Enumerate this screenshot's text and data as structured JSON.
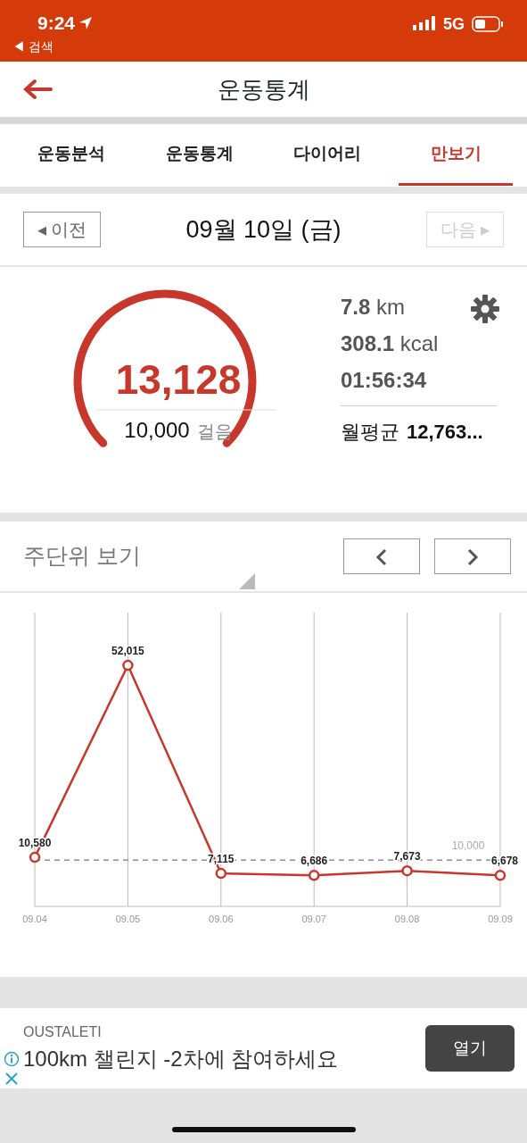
{
  "status_bar": {
    "time": "9:24",
    "back_label": "◀ 검색",
    "network": "5G"
  },
  "header": {
    "title": "운동통계"
  },
  "tabs": [
    {
      "label": "운동분석",
      "selected": false
    },
    {
      "label": "운동통계",
      "selected": false
    },
    {
      "label": "다이어리",
      "selected": false
    },
    {
      "label": "만보기",
      "selected": true
    }
  ],
  "date_nav": {
    "prev": "◂ 이전",
    "date": "09월 10일 (금)",
    "next": "다음 ▸",
    "next_disabled": true
  },
  "steps": {
    "count": "13,128",
    "goal": "10,000",
    "goal_unit": "걸음"
  },
  "stats": [
    {
      "value": "7.8",
      "unit": "km"
    },
    {
      "value": "308.1",
      "unit": "kcal"
    },
    {
      "value": "01:56:34"
    }
  ],
  "monthly": {
    "label": "월평균",
    "value": "12,763..."
  },
  "week_view": {
    "label": "주단위 보기"
  },
  "chart_data": {
    "type": "line",
    "categories": [
      "09.04",
      "09.05",
      "09.06",
      "09.07",
      "09.08",
      "09.09"
    ],
    "series": [
      {
        "color": "#c8372b",
        "marker": "o",
        "values": [
          10580,
          52015,
          7115,
          6686,
          7673,
          6678
        ],
        "value_labels": [
          "10,580",
          "52,015",
          "7,115",
          "6,686",
          "7,673",
          "6,678"
        ]
      }
    ],
    "grid": true,
    "ref_lines": [
      {
        "axis": "y",
        "value": 10000,
        "label": "10,000"
      }
    ]
  },
  "ad": {
    "advertiser": "OUSTALETI",
    "text": "100km 챌린지 -2차에 참여하세요",
    "button": "열기"
  }
}
